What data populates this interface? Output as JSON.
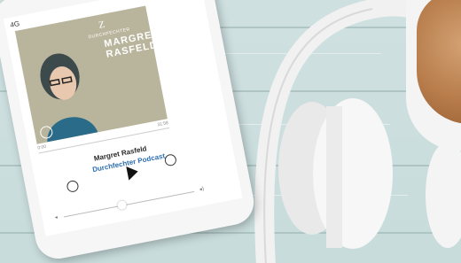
{
  "phone": {
    "status_left": "4G",
    "cover": {
      "publisher": "DURCHFECHTER",
      "title_line1": "MARGRET",
      "title_line2": "RASFELD"
    },
    "player": {
      "time_elapsed": "0:00",
      "time_total": "31:58",
      "speaker": "Margret Rasfeld",
      "podcast": "Durchfechter Podcast"
    }
  },
  "colors": {
    "table": "#cfe0e0",
    "cover_bg": "#b9b59c",
    "podcast_link": "#2e6fae",
    "coffee": "#b77c4a"
  },
  "icons": [
    "skip-back-icon",
    "play-icon",
    "skip-forward-icon",
    "volume-low-icon",
    "volume-high-icon"
  ]
}
